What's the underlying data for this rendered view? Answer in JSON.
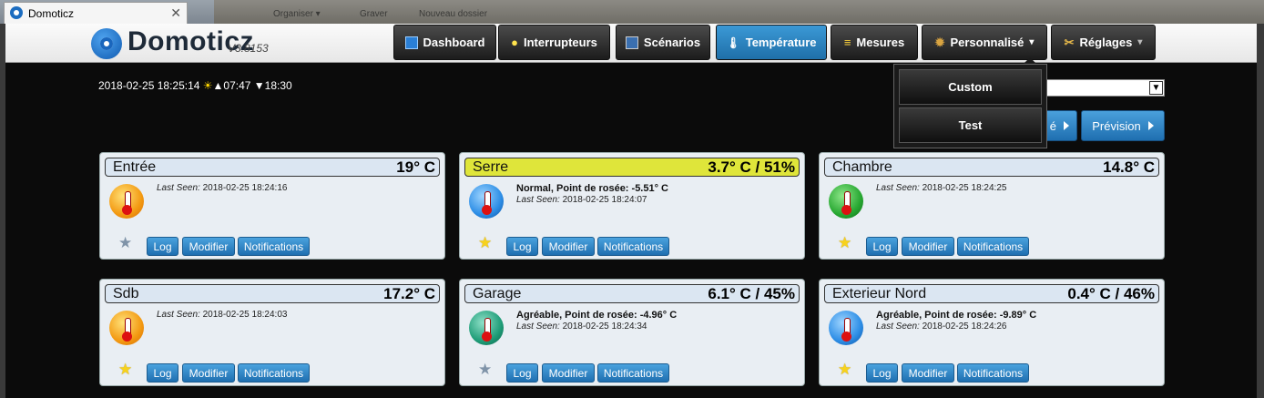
{
  "browser": {
    "tab_title": "Domoticz",
    "close_glyph": "✕",
    "background_texts": [
      "Organiser ▾",
      "Graver",
      "Nouveau dossier"
    ]
  },
  "header": {
    "logo_text": "Domoticz",
    "version": "V3.8153"
  },
  "nav": [
    {
      "label": "Dashboard",
      "icon": "dashboard-icon"
    },
    {
      "label": "Interrupteurs",
      "icon": "bulb-icon"
    },
    {
      "label": "Scénarios",
      "icon": "clapper-icon"
    },
    {
      "label": "Température",
      "icon": "thermometer-icon",
      "active": true
    },
    {
      "label": "Mesures",
      "icon": "meter-icon"
    },
    {
      "label": "Personnalisé",
      "icon": "gear-icon",
      "caret": "▾"
    },
    {
      "label": "Réglages",
      "icon": "tools-icon",
      "caret": "▾"
    }
  ],
  "dropdown": {
    "items": [
      "Custom",
      "Test"
    ]
  },
  "datetime": {
    "timestamp": "2018-02-25 18:25:14",
    "sun_icon": "☀",
    "sunrise": "▲07:47",
    "sunset": "▼18:30"
  },
  "toolbar": {
    "hidden_button_tail": "é",
    "forecast_label": "Prévision"
  },
  "card_buttons": {
    "log": "Log",
    "modify": "Modifier",
    "notifications": "Notifications"
  },
  "cards": [
    {
      "name": "Entrée",
      "value": "19° C",
      "status": "",
      "last_seen_label": "Last Seen:",
      "last_seen": "2018-02-25 18:24:16",
      "star": "grey",
      "icon_color": "orange",
      "highlight": false
    },
    {
      "name": "Serre",
      "value": "3.7° C / 51%",
      "status": "Normal, Point de rosée: -5.51° C",
      "last_seen_label": "Last Seen:",
      "last_seen": "2018-02-25 18:24:07",
      "star": "gold",
      "icon_color": "blue",
      "highlight": true
    },
    {
      "name": "Chambre",
      "value": "14.8° C",
      "status": "",
      "last_seen_label": "Last Seen:",
      "last_seen": "2018-02-25 18:24:25",
      "star": "gold",
      "icon_color": "green",
      "highlight": false
    },
    {
      "name": "Sdb",
      "value": "17.2° C",
      "status": "",
      "last_seen_label": "Last Seen:",
      "last_seen": "2018-02-25 18:24:03",
      "star": "gold",
      "icon_color": "orange",
      "highlight": false
    },
    {
      "name": "Garage",
      "value": "6.1° C / 45%",
      "status": "Agréable, Point de rosée: -4.96° C",
      "last_seen_label": "Last Seen:",
      "last_seen": "2018-02-25 18:24:34",
      "star": "grey",
      "icon_color": "teal",
      "highlight": false
    },
    {
      "name": "Exterieur Nord",
      "value": "0.4° C / 46%",
      "status": "Agréable, Point de rosée: -9.89° C",
      "last_seen_label": "Last Seen:",
      "last_seen": "2018-02-25 18:24:26",
      "star": "gold",
      "icon_color": "blue",
      "highlight": false
    }
  ]
}
